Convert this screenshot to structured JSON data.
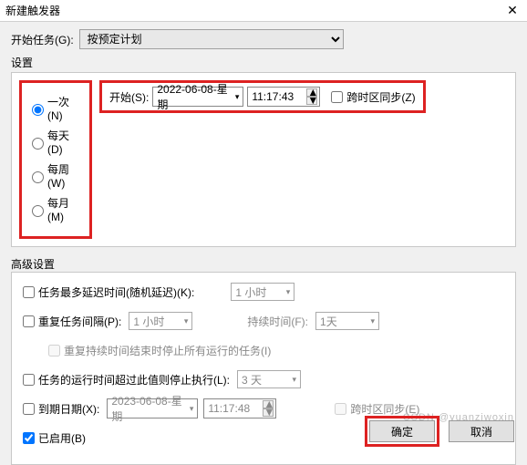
{
  "titlebar": {
    "title": "新建触发器"
  },
  "beginTask": {
    "label": "开始任务(G):",
    "value": "按预定计划"
  },
  "settings": {
    "label": "设置",
    "radios": {
      "once": "一次(N)",
      "daily": "每天(D)",
      "weekly": "每周(W)",
      "monthly": "每月(M)",
      "selected": "once"
    },
    "start": {
      "label": "开始(S):",
      "date": "2022-06-08-星期",
      "time": "11:17:43"
    },
    "tzSync": {
      "label": "跨时区同步(Z)"
    }
  },
  "advanced": {
    "label": "高级设置",
    "delay": {
      "label": "任务最多延迟时间(随机延迟)(K):",
      "value": "1 小时"
    },
    "repeat": {
      "label": "重复任务间隔(P):",
      "value": "1 小时",
      "durationLabel": "持续时间(F):",
      "durationValue": "1天"
    },
    "repeatNote": "重复持续时间结束时停止所有运行的任务(I)",
    "stopAfter": {
      "label": "任务的运行时间超过此值则停止执行(L):",
      "value": "3 天"
    },
    "expire": {
      "label": "到期日期(X):",
      "date": "2023-06-08-星期",
      "time": "11:17:48",
      "tzLabel": "跨时区同步(E)"
    },
    "enabled": {
      "label": "已启用(B)"
    }
  },
  "buttons": {
    "ok": "确定",
    "cancel": "取消"
  },
  "watermark": "CSDN @yuanziwoxin"
}
